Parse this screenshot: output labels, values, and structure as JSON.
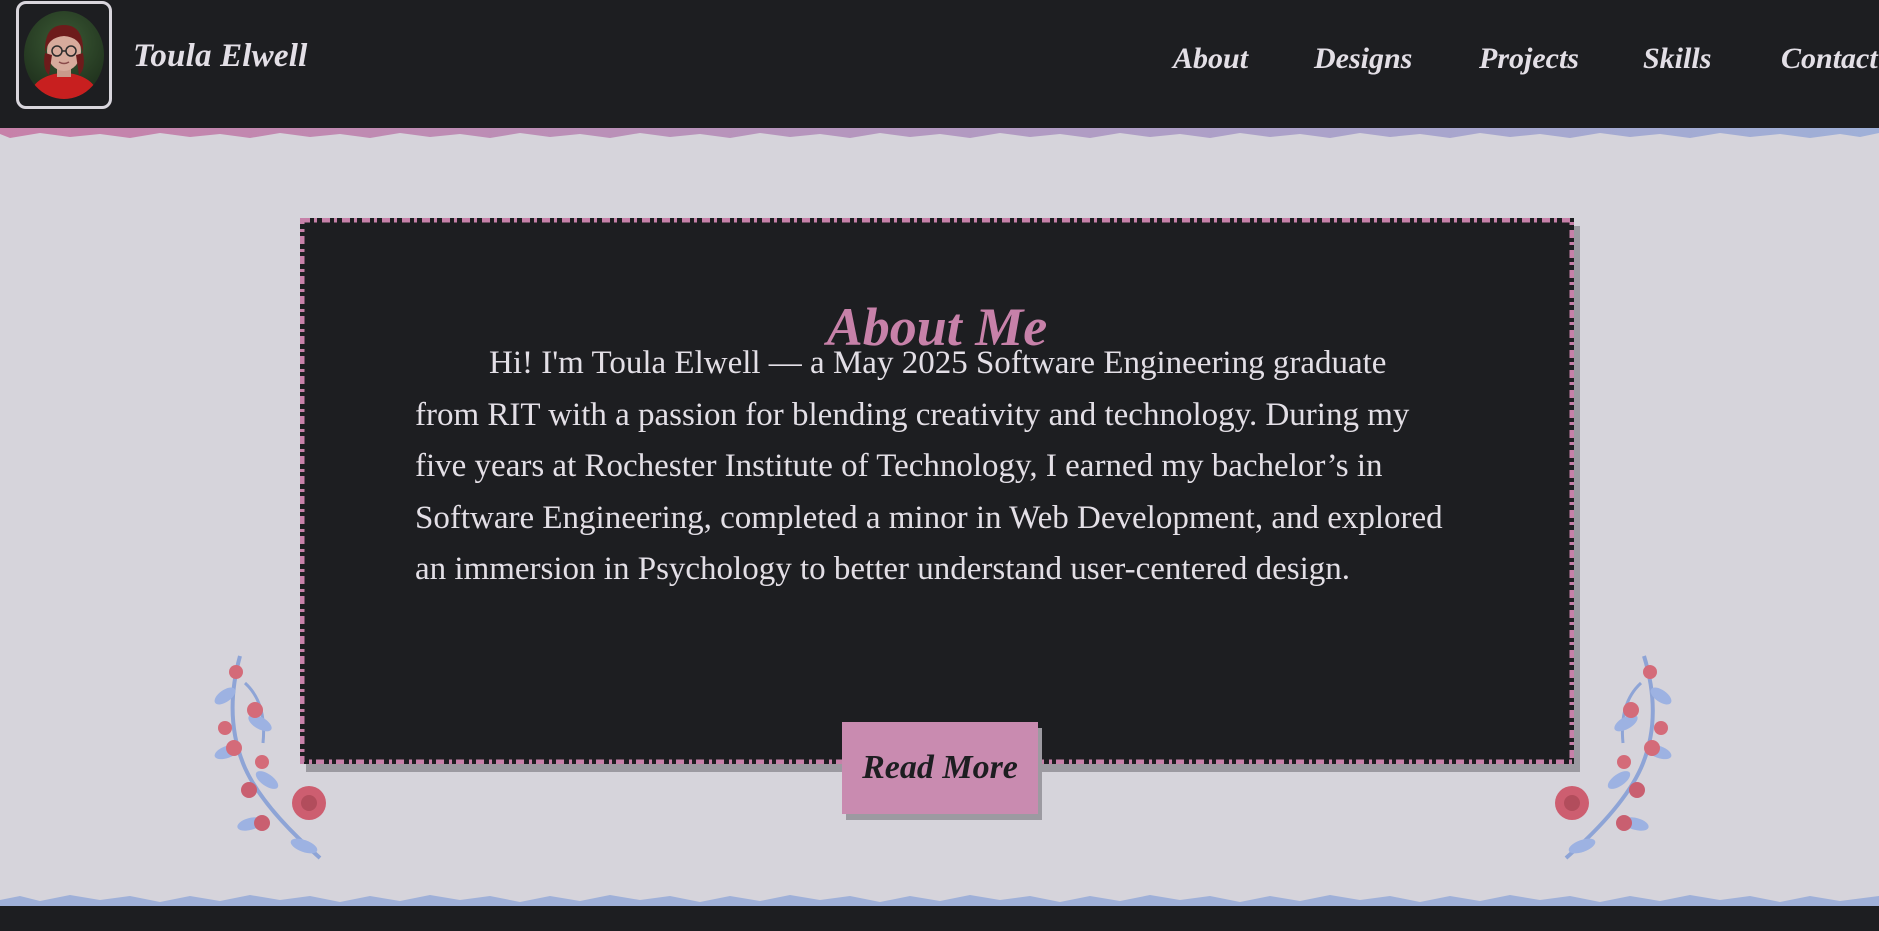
{
  "header": {
    "brand_name": "Toula Elwell",
    "nav": [
      {
        "label": "About"
      },
      {
        "label": "Designs"
      },
      {
        "label": "Projects"
      },
      {
        "label": "Skills"
      },
      {
        "label": "Contact"
      }
    ]
  },
  "about": {
    "title": "About Me",
    "body": "Hi! I'm Toula Elwell — a May 2025 Software Engineering graduate from RIT with a passion for blending creativity and technology. During my five years at Rochester Institute of Technology, I earned my bachelor’s in Software Engineering, completed a minor in Web Development, and explored an immersion in Psychology to better understand user-centered design.",
    "read_more_label": "Read More"
  },
  "colors": {
    "background_dark": "#1d1e21",
    "background_light": "#d6d4db",
    "accent_pink": "#c781a9",
    "accent_blue": "#9fb0d8",
    "text_light": "#e3dfe6"
  },
  "icons": {
    "profile_photo": "avatar",
    "decor_left": "rose-branch-icon",
    "decor_right": "rose-branch-icon"
  }
}
